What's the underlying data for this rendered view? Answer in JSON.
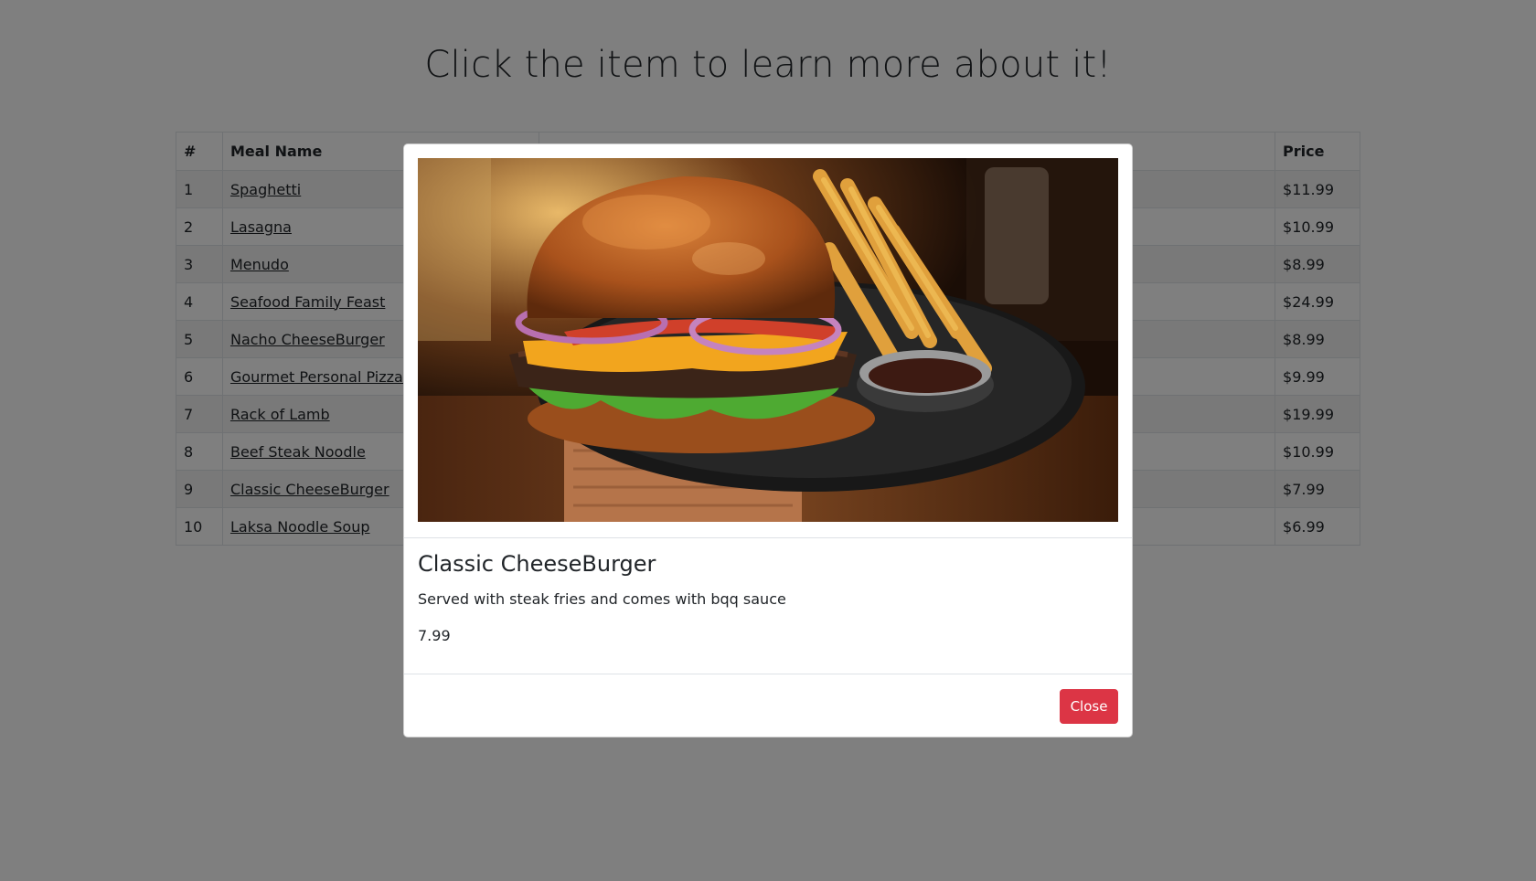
{
  "page": {
    "heading": "Click the item to learn more about it!"
  },
  "table": {
    "headers": {
      "num": "#",
      "name": "Meal Name",
      "description": "",
      "price": "Price"
    },
    "rows": [
      {
        "num": "1",
        "name": "Spaghetti",
        "price": "$11.99"
      },
      {
        "num": "2",
        "name": "Lasagna",
        "price": "$10.99"
      },
      {
        "num": "3",
        "name": "Menudo",
        "price": "$8.99"
      },
      {
        "num": "4",
        "name": "Seafood Family Feast",
        "price": "$24.99"
      },
      {
        "num": "5",
        "name": "Nacho CheeseBurger",
        "price": "$8.99"
      },
      {
        "num": "6",
        "name": "Gourmet Personal Pizza for",
        "price": "$9.99"
      },
      {
        "num": "7",
        "name": "Rack of Lamb",
        "price": "$19.99"
      },
      {
        "num": "8",
        "name": "Beef Steak Noodle",
        "price": "$10.99"
      },
      {
        "num": "9",
        "name": "Classic CheeseBurger",
        "price": "$7.99"
      },
      {
        "num": "10",
        "name": "Laksa Noodle Soup",
        "price": "$6.99"
      }
    ]
  },
  "modal": {
    "title": "Classic CheeseBurger",
    "description": "Served with steak fries and comes with bqq sauce",
    "price": "7.99",
    "close_label": "Close",
    "image_subject": "cheeseburger-with-fries-photo"
  },
  "colors": {
    "backdrop": "rgba(0,0,0,0.5)",
    "close_button": "#dc3545",
    "table_stripe": "#f2f2f2",
    "border": "#dee2e6"
  }
}
